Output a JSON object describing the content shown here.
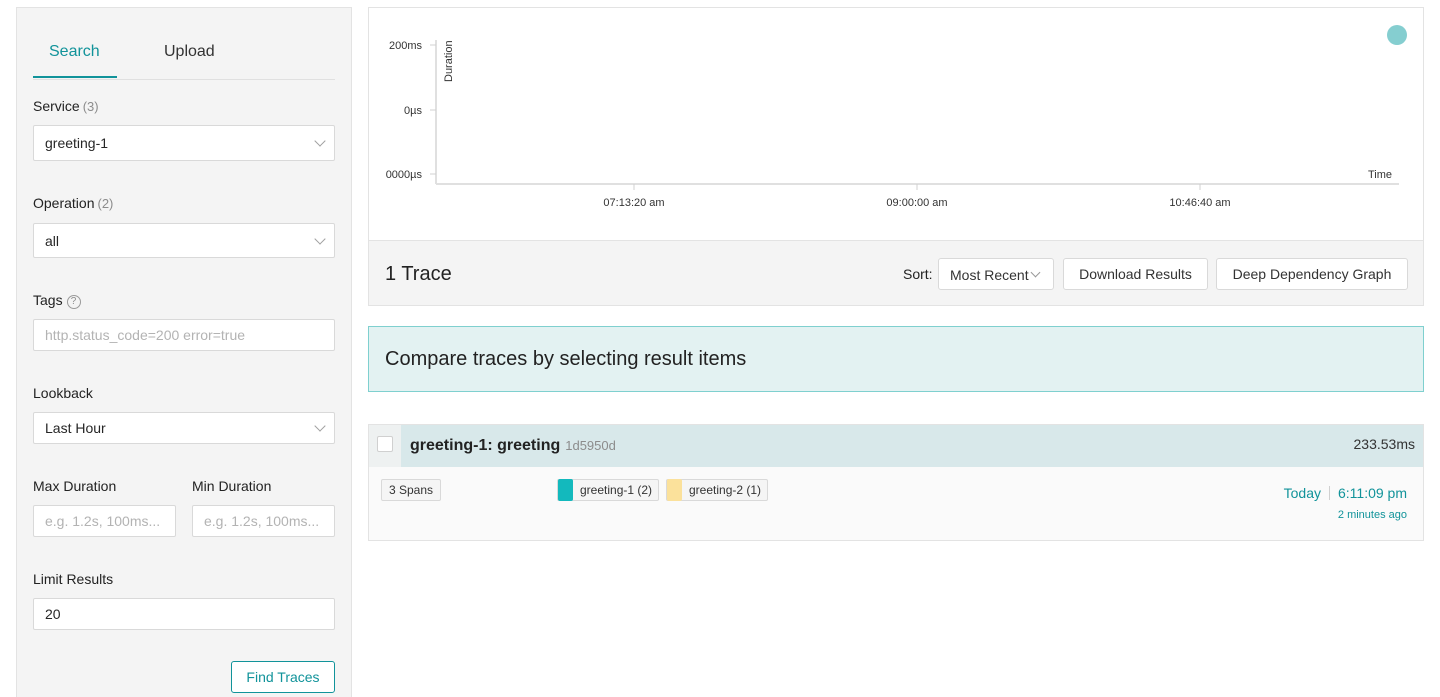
{
  "tabs": {
    "search": "Search",
    "upload": "Upload"
  },
  "form": {
    "service_label": "Service",
    "service_count": "(3)",
    "service_value": "greeting-1",
    "operation_label": "Operation",
    "operation_count": "(2)",
    "operation_value": "all",
    "tags_label": "Tags",
    "tags_help": "?",
    "tags_placeholder": "http.status_code=200 error=true",
    "lookback_label": "Lookback",
    "lookback_value": "Last Hour",
    "max_duration_label": "Max Duration",
    "max_duration_placeholder": "e.g. 1.2s, 100ms...",
    "min_duration_label": "Min Duration",
    "min_duration_placeholder": "e.g. 1.2s, 100ms...",
    "limit_label": "Limit Results",
    "limit_value": "20",
    "find_button": "Find Traces"
  },
  "chart_data": {
    "type": "scatter",
    "ylabel": "Duration",
    "xlabel": "Time",
    "y_ticks": [
      "200ms",
      "0µs",
      "0000µs"
    ],
    "x_ticks": [
      "07:13:20 am",
      "09:00:00 am",
      "10:46:40 am"
    ],
    "points": [
      {
        "x": "6:11:09 pm",
        "y": "233.53ms"
      }
    ],
    "point_color": "#7ecbcd",
    "grid": false
  },
  "results": {
    "count": "1 Trace",
    "sort_label": "Sort:",
    "sort_value": "Most Recent",
    "download_button": "Download Results",
    "ddg_button": "Deep Dependency Graph"
  },
  "compare_banner": "Compare traces by selecting result items",
  "trace": {
    "title": "greeting-1: greeting",
    "id": "1d5950d",
    "duration": "233.53ms",
    "spans": "3 Spans",
    "services": [
      {
        "label": "greeting-1 (2)",
        "color": "#13b9bd"
      },
      {
        "label": "greeting-2 (1)",
        "color": "#fbe19b"
      }
    ],
    "date": "Today",
    "time": "6:11:09 pm",
    "ago": "2 minutes ago"
  }
}
